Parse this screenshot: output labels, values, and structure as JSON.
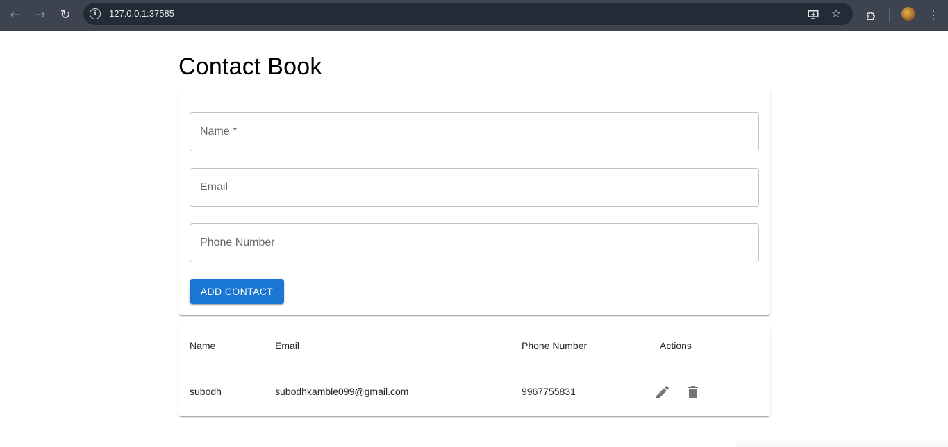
{
  "browser": {
    "url": "127.0.0.1:37585",
    "back_icon": "arrow-left-icon",
    "forward_icon": "arrow-right-icon",
    "reload_icon": "reload-icon",
    "info_icon": "info-icon",
    "install_icon": "install-app-icon",
    "star_icon": "star-icon",
    "extensions_icon": "puzzle-icon",
    "menu_icon": "kebab-menu-icon"
  },
  "page": {
    "title": "Contact Book"
  },
  "form": {
    "name_placeholder": "Name *",
    "email_placeholder": "Email",
    "phone_placeholder": "Phone Number",
    "name_value": "",
    "email_value": "",
    "phone_value": "",
    "submit_label": "ADD CONTACT",
    "accent_color": "#1976d2"
  },
  "table": {
    "headers": [
      "Name",
      "Email",
      "Phone Number",
      "Actions"
    ],
    "rows": [
      {
        "name": "subodh",
        "email": "subodhkamble099@gmail.com",
        "phone": "9967755831",
        "actions": [
          "edit-icon",
          "delete-icon"
        ]
      }
    ]
  }
}
